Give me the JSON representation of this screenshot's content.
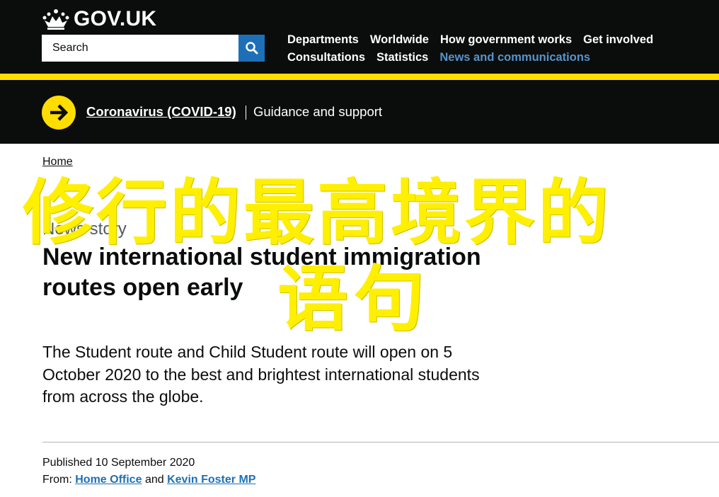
{
  "header": {
    "logo_text": "GOV.UK",
    "search": {
      "placeholder": "Search"
    },
    "nav": {
      "row1": [
        "Departments",
        "Worldwide",
        "How government works",
        "Get involved"
      ],
      "row2": [
        "Consultations",
        "Statistics",
        "News and communications"
      ]
    }
  },
  "covid_banner": {
    "link": "Coronavirus (COVID-19)",
    "text": "Guidance and support"
  },
  "breadcrumb": {
    "home": "Home"
  },
  "article": {
    "caption": "News story",
    "title": "New international student immigration routes open early",
    "lead": "The Student route and Child Student route will open on 5 October 2020 to the best and brightest international students from across the globe.",
    "published_label": "Published",
    "published_date": "10 September 2020",
    "from_label": "From:",
    "from_1": "Home Office",
    "and": "and",
    "from_2": "Kevin Foster MP"
  },
  "watermark": {
    "line1": "修行的最高境界的",
    "line2": "语句"
  },
  "colors": {
    "header_bg": "#0b0c0c",
    "accent_yellow": "#ffdd00",
    "link_blue": "#1d70b8",
    "watermark": "#ffef00"
  },
  "icons": [
    "crown-icon",
    "search-icon",
    "arrow-right-circle-icon"
  ]
}
